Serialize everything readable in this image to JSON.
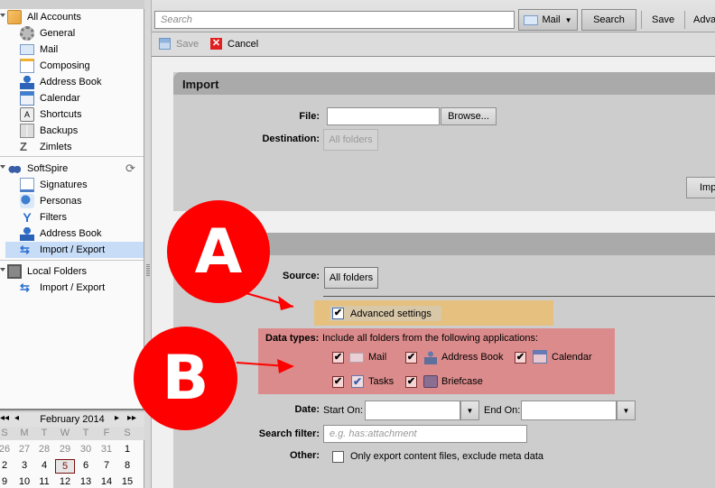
{
  "sidebar": {
    "all_accounts": {
      "label": "All Accounts",
      "items": [
        {
          "label": "General",
          "icon": "gear-icon"
        },
        {
          "label": "Mail",
          "icon": "mail-icon"
        },
        {
          "label": "Composing",
          "icon": "compose-icon"
        },
        {
          "label": "Address Book",
          "icon": "address-book-icon"
        },
        {
          "label": "Calendar",
          "icon": "calendar-icon"
        },
        {
          "label": "Shortcuts",
          "icon": "shortcuts-icon"
        },
        {
          "label": "Backups",
          "icon": "backups-icon"
        },
        {
          "label": "Zimlets",
          "icon": "zimlets-icon"
        }
      ]
    },
    "softspire": {
      "label": "SoftSpire",
      "items": [
        {
          "label": "Signatures",
          "icon": "signature-icon"
        },
        {
          "label": "Personas",
          "icon": "personas-icon"
        },
        {
          "label": "Filters",
          "icon": "filters-icon"
        },
        {
          "label": "Address Book",
          "icon": "address-book-icon"
        },
        {
          "label": "Import / Export",
          "icon": "import-export-icon",
          "selected": true
        }
      ]
    },
    "local_folders": {
      "label": "Local Folders",
      "items": [
        {
          "label": "Import / Export",
          "icon": "import-export-icon"
        }
      ]
    }
  },
  "calendar": {
    "month_label": "February 2014",
    "days_of_week": [
      "S",
      "M",
      "T",
      "W",
      "T",
      "F",
      "S"
    ],
    "weeks": [
      [
        "26",
        "27",
        "28",
        "29",
        "30",
        "31",
        "1"
      ],
      [
        "2",
        "3",
        "4",
        "5",
        "6",
        "7",
        "8"
      ],
      [
        "9",
        "10",
        "11",
        "12",
        "13",
        "14",
        "15"
      ]
    ],
    "today": "5"
  },
  "toolbar": {
    "search_placeholder": "Search",
    "mail_dropdown": "Mail",
    "search_button": "Search",
    "save_button": "Save",
    "advanced_button": "Adva"
  },
  "actions": {
    "save": "Save",
    "cancel": "Cancel"
  },
  "import": {
    "title": "Import",
    "file_label": "File:",
    "browse": "Browse...",
    "destination_label": "Destination:",
    "destination_value": "All folders",
    "import_button": "Imp"
  },
  "export": {
    "source_label": "Source:",
    "source_value": "All folders",
    "advanced_settings": "Advanced settings",
    "advanced_checked": true,
    "data_types_label": "Data types:",
    "data_types_desc": "Include all folders from the following applications:",
    "data_types": [
      {
        "label": "Mail",
        "checked": true,
        "icon": "mail-icon"
      },
      {
        "label": "Address Book",
        "checked": true,
        "icon": "address-book-icon"
      },
      {
        "label": "Calendar",
        "checked": true,
        "icon": "calendar-icon"
      },
      {
        "label": "Tasks",
        "checked": true,
        "icon": "tasks-icon"
      },
      {
        "label": "Briefcase",
        "checked": true,
        "icon": "briefcase-icon"
      }
    ],
    "date_label": "Date:",
    "start_on": "Start On:",
    "end_on": "End On:",
    "search_filter_label": "Search filter:",
    "search_filter_placeholder": "e.g. has:attachment",
    "other_label": "Other:",
    "other_option": "Only export content files, exclude meta data"
  },
  "annotations": {
    "a": "A",
    "b": "B",
    "color": "#ff0000",
    "highlight_a": "#e5c07f",
    "highlight_b": "#db8b8b"
  }
}
